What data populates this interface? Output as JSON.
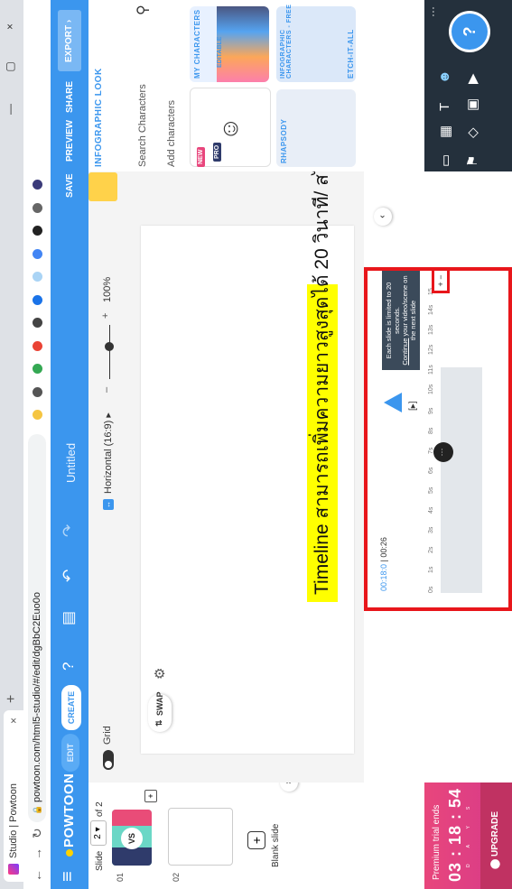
{
  "browser": {
    "tab_title": "Studio | Powtoon",
    "tab_close": "×",
    "new_tab": "+",
    "url": "powtoon.com/html5-studio/#/edit/dgBbC2Euo0o",
    "window_controls": "— ▢ ×"
  },
  "app": {
    "logo": "POWTOON",
    "edit_label": "EDIT",
    "create_label": "CREATE",
    "doc_name": "Untitled",
    "save_label": "SAVE",
    "preview_label": "PREVIEW",
    "share_label": "SHARE",
    "export_label": "EXPORT",
    "accent": "#3b96ee"
  },
  "slides": {
    "label": "Slide",
    "current": "2 ▾",
    "of_text": "of 2",
    "numbers": [
      "01",
      "02"
    ],
    "vs_text": "VS",
    "blank_label": "Blank slide"
  },
  "trial": {
    "title": "Premium trial ends",
    "time": "03 : 18 : 54",
    "units": "DAYS HOURS MINS",
    "upgrade_label": "UPGRADE"
  },
  "canvas_toolbar": {
    "grid_label": "Grid",
    "ratio_label": "Horizontal (16:9)",
    "zoom_label": "100%",
    "swap_label": "SWAP"
  },
  "annotation": "Timeline สามารถเพิ่มความยาวสูงสุดได้ 20 วินาที/ สไลด์",
  "timeline": {
    "current": "00:18:0",
    "total": "00:26",
    "ruler": [
      "0s",
      "1s",
      "2s",
      "3s",
      "4s",
      "5s",
      "6s",
      "7s",
      "8s",
      "9s",
      "10s",
      "11s",
      "12s",
      "13s",
      "14s",
      "15"
    ],
    "tooltip_line1": "Each slide is limited to 20 seconds.",
    "tooltip_link": "Continue",
    "tooltip_line2": " your video/scene on the next slide",
    "plus_minus": "+ −"
  },
  "panel": {
    "section_title": "INFOGRAPHIC LOOK",
    "search_placeholder": "Search Characters",
    "add_characters": "Add characters",
    "cards": [
      "MY CHARACTERS",
      "RHAPSODY",
      "INFOGRAPHIC CHARACTERS - FREE",
      "ETCH-IT-ALL"
    ],
    "badges": {
      "new": "NEW",
      "pro": "PRO",
      "editable": "EDITABLE"
    }
  },
  "help_label": "?",
  "more_label": "···"
}
